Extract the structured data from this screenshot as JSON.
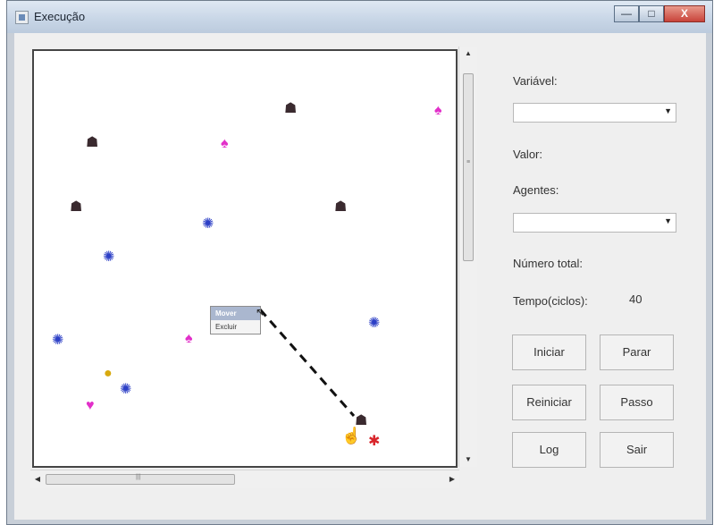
{
  "window": {
    "title": "Execução",
    "minimize": "—",
    "maximize": "□",
    "close": "X"
  },
  "canvas": {
    "context_menu": {
      "items": [
        "Mover",
        "Excluir"
      ],
      "selected": "Mover"
    }
  },
  "icons": {
    "dark_agent": "dark-agent-icon",
    "pink_agent": "pink-agent-icon",
    "blue_agent": "blue-agent-icon",
    "heart": "heart-icon",
    "coin": "coin-icon",
    "red_agent": "red-agent-icon",
    "hand_cursor": "hand-cursor-icon",
    "pointer_cursor": "pointer-cursor-icon"
  },
  "panel": {
    "variavel_label": "Variável:",
    "variavel_value": "",
    "valor_label": "Valor:",
    "agentes_label": "Agentes:",
    "agentes_value": "",
    "numero_total_label": "Número total:",
    "tempo_label": "Tempo(ciclos):",
    "tempo_value": "40"
  },
  "buttons": {
    "iniciar": "Iniciar",
    "parar": "Parar",
    "reiniciar": "Reiniciar",
    "passo": "Passo",
    "log": "Log",
    "sair": "Sair"
  },
  "colors": {
    "dark_agent": "#3a2a2f",
    "pink_agent": "#e22fc9",
    "blue_agent": "#2c3fc6",
    "red_agent": "#d8242a",
    "coin": "#d8a90e"
  }
}
